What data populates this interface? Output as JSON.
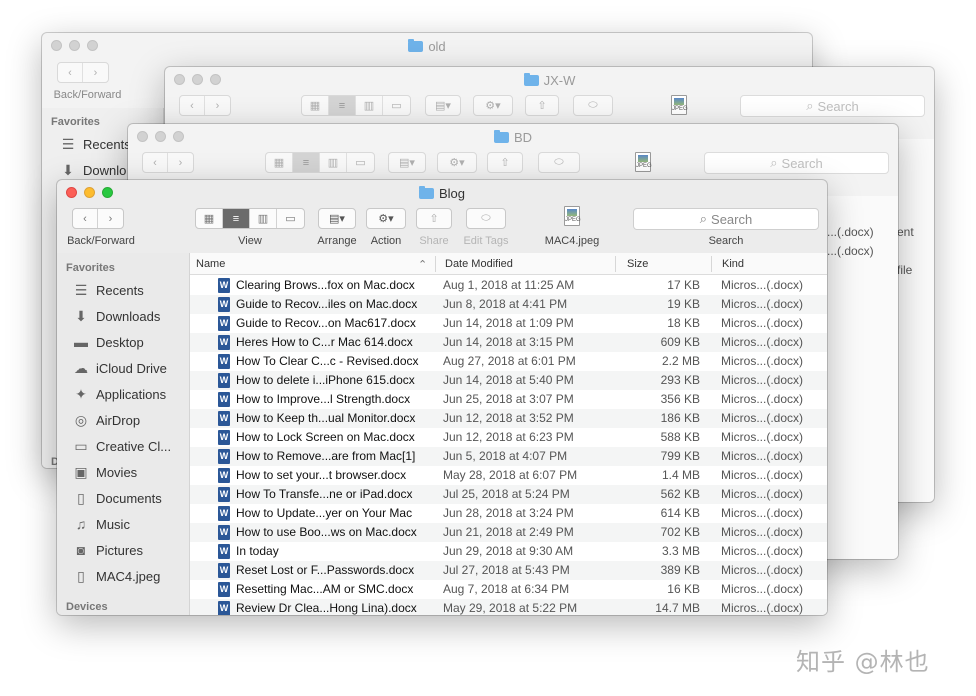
{
  "windows": {
    "old": {
      "title": "old",
      "back_forward_label": "Back/Forward",
      "favorites_header": "Favorites",
      "sidebar_peek": [
        "Recents",
        "Downlo"
      ],
      "devices_peek": "D"
    },
    "jxw": {
      "title": "JX-W",
      "search_placeholder": "Search",
      "peek_rows": [
        "ent",
        "file"
      ],
      "jpeg_label": "JPEG"
    },
    "bd": {
      "title": "BD",
      "search_placeholder": "Search",
      "peek_rows": [
        "s...(.docx)",
        "s...(.docx)"
      ],
      "jpeg_label": "JPEG"
    },
    "blog": {
      "title": "Blog",
      "toolbar": {
        "back_forward_label": "Back/Forward",
        "view_label": "View",
        "arrange_label": "Arrange",
        "action_label": "Action",
        "share_label": "Share",
        "edit_tags_label": "Edit Tags",
        "file_label": "MAC4.jpeg",
        "jpeg_badge": "JPEG",
        "search_label": "Search",
        "search_placeholder": "Search"
      },
      "sidebar": {
        "favorites_header": "Favorites",
        "devices_header": "Devices",
        "items": [
          {
            "label": "Recents",
            "icon": "recents-icon"
          },
          {
            "label": "Downloads",
            "icon": "downloads-icon"
          },
          {
            "label": "Desktop",
            "icon": "desktop-icon"
          },
          {
            "label": "iCloud Drive",
            "icon": "cloud-icon"
          },
          {
            "label": "Applications",
            "icon": "applications-icon"
          },
          {
            "label": "AirDrop",
            "icon": "airdrop-icon"
          },
          {
            "label": "Creative Cl...",
            "icon": "folder-icon"
          },
          {
            "label": "Movies",
            "icon": "movies-icon"
          },
          {
            "label": "Documents",
            "icon": "documents-icon"
          },
          {
            "label": "Music",
            "icon": "music-icon"
          },
          {
            "label": "Pictures",
            "icon": "pictures-icon"
          },
          {
            "label": "MAC4.jpeg",
            "icon": "file-icon"
          }
        ]
      },
      "columns": {
        "name": "Name",
        "date": "Date Modified",
        "size": "Size",
        "kind": "Kind"
      },
      "docx_glyph": "W",
      "files": [
        {
          "name": "Clearing Brows...fox on Mac.docx",
          "date": "Aug 1, 2018 at 11:25 AM",
          "size": "17 KB",
          "kind": "Micros...(.docx)"
        },
        {
          "name": "Guide to Recov...iles on Mac.docx",
          "date": "Jun 8, 2018 at 4:41 PM",
          "size": "19 KB",
          "kind": "Micros...(.docx)"
        },
        {
          "name": "Guide to Recov...on Mac617.docx",
          "date": "Jun 14, 2018 at 1:09 PM",
          "size": "18 KB",
          "kind": "Micros...(.docx)"
        },
        {
          "name": "Heres How to C...r Mac 614.docx",
          "date": "Jun 14, 2018 at 3:15 PM",
          "size": "609 KB",
          "kind": "Micros...(.docx)"
        },
        {
          "name": "How To Clear C...c - Revised.docx",
          "date": "Aug 27, 2018 at 6:01 PM",
          "size": "2.2 MB",
          "kind": "Micros...(.docx)"
        },
        {
          "name": "How to delete i...iPhone 615.docx",
          "date": "Jun 14, 2018 at 5:40 PM",
          "size": "293 KB",
          "kind": "Micros...(.docx)"
        },
        {
          "name": "How to Improve...l Strength.docx",
          "date": "Jun 25, 2018 at 3:07 PM",
          "size": "356 KB",
          "kind": "Micros...(.docx)"
        },
        {
          "name": "How to Keep th...ual Monitor.docx",
          "date": "Jun 12, 2018 at 3:52 PM",
          "size": "186 KB",
          "kind": "Micros...(.docx)"
        },
        {
          "name": "How to Lock Screen on Mac.docx",
          "date": "Jun 12, 2018 at 6:23 PM",
          "size": "588 KB",
          "kind": "Micros...(.docx)"
        },
        {
          "name": "How to Remove...are from Mac[1]",
          "date": "Jun 5, 2018 at 4:07 PM",
          "size": "799 KB",
          "kind": "Micros...(.docx)"
        },
        {
          "name": "How to set your...t browser.docx",
          "date": "May 28, 2018 at 6:07 PM",
          "size": "1.4 MB",
          "kind": "Micros...(.docx)"
        },
        {
          "name": "How To Transfe...ne or iPad.docx",
          "date": "Jul 25, 2018 at 5:24 PM",
          "size": "562 KB",
          "kind": "Micros...(.docx)"
        },
        {
          "name": "How to Update...yer on Your Mac",
          "date": "Jun 28, 2018 at 3:24 PM",
          "size": "614 KB",
          "kind": "Micros...(.docx)"
        },
        {
          "name": "How to use Boo...ws on Mac.docx",
          "date": "Jun 21, 2018 at 2:49 PM",
          "size": "702 KB",
          "kind": "Micros...(.docx)"
        },
        {
          "name": "In today",
          "date": "Jun 29, 2018 at 9:30 AM",
          "size": "3.3 MB",
          "kind": "Micros...(.docx)"
        },
        {
          "name": "Reset Lost or F...Passwords.docx",
          "date": "Jul 27, 2018 at 5:43 PM",
          "size": "389 KB",
          "kind": "Micros...(.docx)"
        },
        {
          "name": "Resetting Mac...AM or SMC.docx",
          "date": "Aug 7, 2018 at 6:34 PM",
          "size": "16 KB",
          "kind": "Micros...(.docx)"
        },
        {
          "name": "Review Dr Clea...Hong Lina).docx",
          "date": "May 29, 2018 at 5:22 PM",
          "size": "14.7 MB",
          "kind": "Micros...(.docx)"
        }
      ]
    }
  },
  "watermark": "知乎 @林也"
}
